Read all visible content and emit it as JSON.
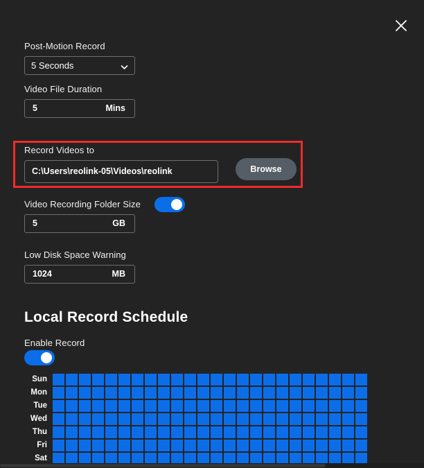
{
  "dialog": {
    "close_icon": "close-icon"
  },
  "post_motion": {
    "label": "Post-Motion Record",
    "value": "5 Seconds",
    "chevron_icon": "chevron-down-icon"
  },
  "video_file_duration": {
    "label": "Video File Duration",
    "value": "5",
    "unit": "Mins"
  },
  "record_videos_to": {
    "label": "Record Videos to",
    "path": "C:\\Users\\reolink-05\\Videos\\reolink",
    "browse_label": "Browse",
    "highlight_color": "#f22b2b"
  },
  "folder_size": {
    "label": "Video Recording Folder Size",
    "toggle_on": true,
    "value": "5",
    "unit": "GB"
  },
  "low_disk_warning": {
    "label": "Low Disk Space Warning",
    "value": "1024",
    "unit": "MB"
  },
  "schedule": {
    "title": "Local Record Schedule",
    "enable_label": "Enable Record",
    "enable_on": true,
    "accent_color": "#0b6ee8",
    "columns": 24,
    "days": [
      {
        "label": "Sun",
        "cells": [
          1,
          1,
          1,
          1,
          1,
          1,
          1,
          1,
          1,
          1,
          1,
          1,
          1,
          1,
          1,
          1,
          1,
          1,
          1,
          1,
          1,
          1,
          1,
          1
        ]
      },
      {
        "label": "Mon",
        "cells": [
          1,
          1,
          1,
          1,
          1,
          1,
          1,
          1,
          1,
          1,
          1,
          1,
          1,
          1,
          1,
          1,
          1,
          1,
          1,
          1,
          1,
          1,
          1,
          1
        ]
      },
      {
        "label": "Tue",
        "cells": [
          1,
          1,
          1,
          1,
          1,
          1,
          1,
          1,
          1,
          1,
          1,
          1,
          1,
          1,
          1,
          1,
          1,
          1,
          1,
          1,
          1,
          1,
          1,
          1
        ]
      },
      {
        "label": "Wed",
        "cells": [
          1,
          1,
          1,
          1,
          1,
          1,
          1,
          1,
          1,
          1,
          1,
          1,
          1,
          1,
          1,
          1,
          1,
          1,
          1,
          1,
          1,
          1,
          1,
          1
        ]
      },
      {
        "label": "Thu",
        "cells": [
          1,
          1,
          1,
          1,
          1,
          1,
          1,
          1,
          1,
          1,
          1,
          1,
          1,
          1,
          1,
          1,
          1,
          1,
          1,
          1,
          1,
          1,
          1,
          1
        ]
      },
      {
        "label": "Fri",
        "cells": [
          1,
          1,
          1,
          1,
          1,
          1,
          1,
          1,
          1,
          1,
          1,
          1,
          1,
          1,
          1,
          1,
          1,
          1,
          1,
          1,
          1,
          1,
          1,
          1
        ]
      },
      {
        "label": "Sat",
        "cells": [
          1,
          1,
          1,
          1,
          1,
          1,
          1,
          1,
          1,
          1,
          1,
          1,
          1,
          1,
          1,
          1,
          1,
          1,
          1,
          1,
          1,
          1,
          1,
          1
        ]
      }
    ]
  }
}
